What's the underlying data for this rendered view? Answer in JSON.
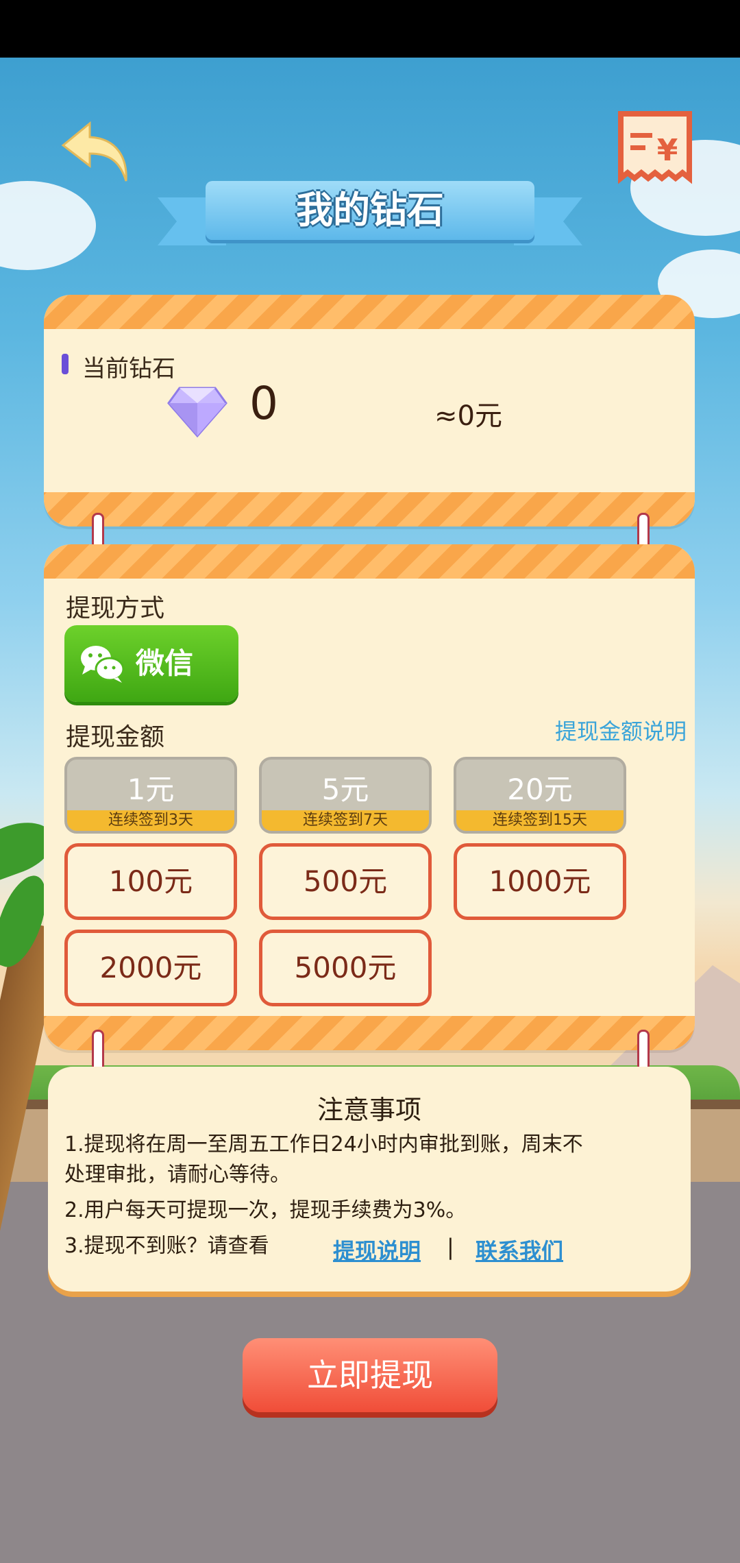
{
  "header": {
    "title": "我的钻石"
  },
  "diamond": {
    "label": "当前钻石",
    "value": "0",
    "approx": "≈0元"
  },
  "withdraw": {
    "method_label": "提现方式",
    "method": "微信",
    "amount_label": "提现金额",
    "amount_explain_link": "提现金额说明",
    "tiers": [
      {
        "value": "1元",
        "condition": "连续签到3天"
      },
      {
        "value": "5元",
        "condition": "连续签到7天"
      },
      {
        "value": "20元",
        "condition": "连续签到15天"
      }
    ],
    "amounts": [
      "100元",
      "500元",
      "1000元",
      "2000元",
      "5000元"
    ]
  },
  "notice": {
    "title": "注意事项",
    "line1a": "1.提现将在周一至周五工作日24小时内审批到账，周末不",
    "line1b": "处理审批，请耐心等待。",
    "line2": "2.用户每天可提现一次，提现手续费为3%。",
    "line3": "3.提现不到账？请查看",
    "link_explain": "提现说明",
    "separator": "|",
    "link_contact": "联系我们"
  },
  "action": {
    "withdraw_now": "立即提现"
  },
  "colors": {
    "card_bg": "#fdf2d4",
    "stripe": "#f9a64a",
    "wechat_green": "#4fb81c",
    "amount_border": "#e05a3a",
    "link_blue": "#2d8fd0",
    "cta_red": "#f04d38"
  },
  "icons": {
    "back": "back-arrow-icon",
    "receipt": "receipt-yen-icon",
    "gem": "diamond-icon",
    "wechat": "wechat-icon"
  }
}
